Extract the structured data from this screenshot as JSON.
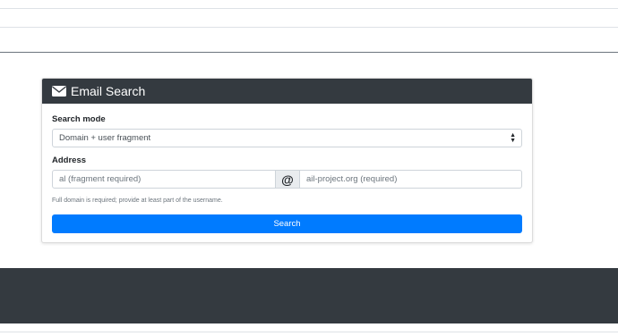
{
  "card": {
    "title": "Email Search",
    "title_icon": "envelope-icon"
  },
  "form": {
    "search_mode_label": "Search mode",
    "search_mode_value": "Domain + user fragment",
    "address_label": "Address",
    "user_placeholder": "al (fragment required)",
    "at_symbol": "@",
    "domain_placeholder": "ail-project.org (required)",
    "help_text": "Full domain is required; provide at least part of the username.",
    "search_button": "Search"
  },
  "colors": {
    "header_bg": "#343a40",
    "accent": "#007bff",
    "footer_bg": "#343a40"
  }
}
